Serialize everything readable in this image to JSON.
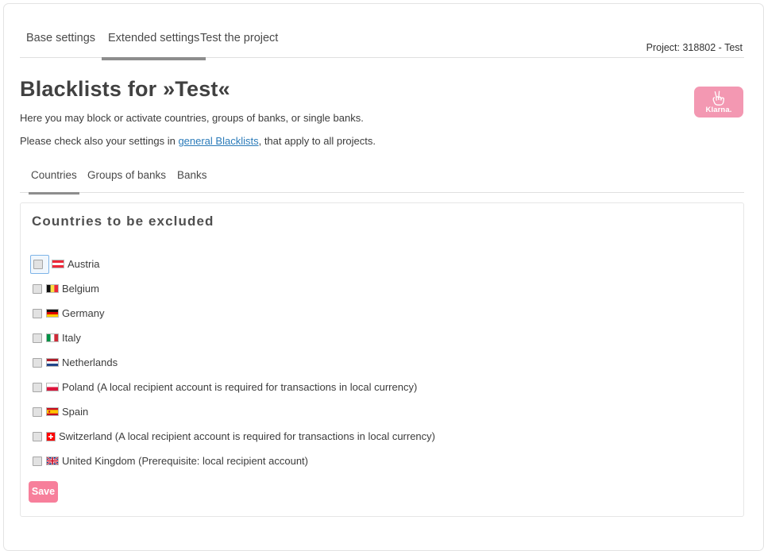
{
  "header": {
    "tabs": [
      {
        "label": "Base settings",
        "active": false
      },
      {
        "label": "Extended settings",
        "active": true
      },
      {
        "label": "Test the project",
        "active": false
      }
    ],
    "project_label": "Project: 318802 - Test"
  },
  "heading": {
    "title": "Blacklists for »Test«",
    "intro_line1": "Here you may block or activate countries, groups of banks, or single banks.",
    "intro_line2_before": "Please check also your settings in ",
    "intro_line2_link": "general Blacklists",
    "intro_line2_after": ", that apply to all projects."
  },
  "brand": {
    "name": "Klarna.",
    "badge_color": "#f398b2",
    "icon": "peace-hand-icon"
  },
  "subtabs": [
    {
      "label": "Countries",
      "active": true
    },
    {
      "label": "Groups of banks",
      "active": false
    },
    {
      "label": "Banks",
      "active": false
    }
  ],
  "panel": {
    "title": "Countries to be excluded",
    "countries": [
      {
        "label": "Austria",
        "flag": "at-flag",
        "checked": false,
        "focused": true
      },
      {
        "label": "Belgium",
        "flag": "be-flag",
        "checked": false,
        "focused": false
      },
      {
        "label": "Germany",
        "flag": "de-flag",
        "checked": false,
        "focused": false
      },
      {
        "label": "Italy",
        "flag": "it-flag",
        "checked": false,
        "focused": false
      },
      {
        "label": "Netherlands",
        "flag": "nl-flag",
        "checked": false,
        "focused": false
      },
      {
        "label": "Poland (A local recipient account is required for transactions in local currency)",
        "flag": "pl-flag",
        "checked": false,
        "focused": false
      },
      {
        "label": "Spain",
        "flag": "es-flag",
        "checked": false,
        "focused": false
      },
      {
        "label": "Switzerland (A local recipient account is required for transactions in local currency)",
        "flag": "ch-flag",
        "checked": false,
        "focused": false
      },
      {
        "label": "United Kingdom (Prerequisite: local recipient account)",
        "flag": "gb-flag",
        "checked": false,
        "focused": false
      }
    ]
  },
  "actions": {
    "save_label": "Save",
    "save_color": "#f77f9b"
  }
}
